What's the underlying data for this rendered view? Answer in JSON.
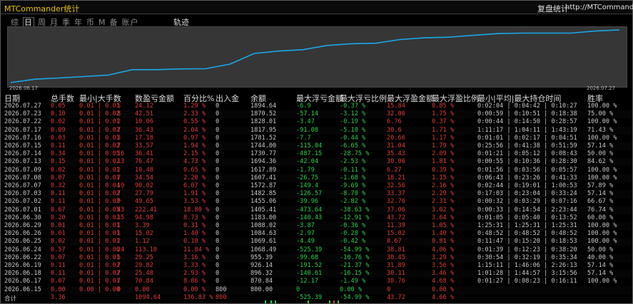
{
  "window": {
    "title": "MTCommander统计",
    "replay_label": "复盘统计",
    "url": "http://MTCommander"
  },
  "tabs": [
    "综",
    "日",
    "周",
    "月",
    "季",
    "年",
    "币",
    "M",
    "备",
    "账户"
  ],
  "selected_tab": "日",
  "track_label": "轨迹",
  "chart": {
    "start_date": "2026.06.17",
    "end_date": "2026.07.27",
    "line_color": "#1aa8e8",
    "bg_color": "#363636"
  },
  "chart_data": {
    "type": "line",
    "x": [
      "2026.06.17",
      "2026.06.18",
      "2026.06.19",
      "2026.06.22",
      "2026.06.24",
      "2026.06.25",
      "2026.06.26",
      "2026.06.29",
      "2026.06.30",
      "2026.07.01",
      "2026.07.02",
      "2026.07.03",
      "2026.07.06",
      "2026.07.07",
      "2026.07.08",
      "2026.07.09",
      "2026.07.13",
      "2026.07.14",
      "2026.07.15",
      "2026.07.16",
      "2026.07.17",
      "2026.07.20",
      "2026.07.21",
      "2026.07.22",
      "2026.07.23",
      "2026.07.27"
    ],
    "values": [
      800.0,
      870.84,
      896.32,
      926.14,
      955.39,
      1068.49,
      1069.61,
      1084.63,
      1088.02,
      1183.0,
      1405.41,
      1455.06,
      1482.85,
      1572.87,
      1607.41,
      1617.89,
      1694.36,
      1730.77,
      1744.0,
      1781.52,
      1817.95,
      1828.01,
      1828.01,
      1828.01,
      1870.52,
      1894.64
    ],
    "title": "",
    "xlabel": "",
    "ylabel": ""
  },
  "headers": {
    "date": "日期",
    "total": "总手数",
    "minmax": "最小|大手数",
    "count": "数盈亏金额",
    "pct": "百分比%",
    "io": "出入金",
    "balance": "余额",
    "max_float_loss": "最大浮亏金额",
    "max_float_loss_pct": "最大浮亏比例",
    "max_float_profit": "最大浮盈金额",
    "max_float_profit_pct": "最大浮盈比例",
    "hold_time": "最小|平均|最大持仓时间",
    "winrate": "胜率"
  },
  "rows": [
    {
      "date": "2026.07.27",
      "total": "0.05",
      "minmax": "0.01 | 0.01",
      "cnt": "5",
      "amt": "24.12",
      "pct": "1.29 %",
      "io": "0",
      "bal": "1894.64",
      "fl": "-6.9",
      "flp": "-0.37 %",
      "fp": "15.84",
      "fpp": "0.85 %",
      "ts": "0:02:04 | 0:04:42 | 0:10:27",
      "win": "100.00 %"
    },
    {
      "date": "2026.07.23",
      "total": "0.10",
      "minmax": "0.01 | 0.02",
      "cnt": "8",
      "amt": "42.51",
      "pct": "2.33 %",
      "io": "0",
      "bal": "1870.52",
      "fl": "-57.14",
      "flp": "-3.12 %",
      "fp": "32.06",
      "fpp": "1.75 %",
      "ts": "0:00:59 | 0:10:51 | 0:18:38",
      "win": "75.00 %"
    },
    {
      "date": "2026.07.22",
      "total": "0.02",
      "minmax": "0.01 | 0.01",
      "cnt": "2",
      "amt": "10.06",
      "pct": "0.55 %",
      "io": "0",
      "bal": "1828.01",
      "fl": "-3.47",
      "flp": "-0.19 %",
      "fp": "6.76",
      "fpp": "0.37 %",
      "ts": "0:00:44 | 0:14:50 | 0:28:57",
      "win": "100.00 %"
    },
    {
      "date": "2026.07.17",
      "total": "0.09",
      "minmax": "0.01 | 0.02",
      "cnt": "7",
      "amt": "36.43",
      "pct": "2.04 %",
      "io": "0",
      "bal": "1817.95",
      "fl": "-91.08",
      "flp": "-5.10 %",
      "fp": "30.6",
      "fpp": "1.71 %",
      "ts": "1:11:17 | 1:04:11 | 1:43:19",
      "win": "71.43 %"
    },
    {
      "date": "2026.07.16",
      "total": "0.03",
      "minmax": "0.01 | 0.01",
      "cnt": "3",
      "amt": "17.18",
      "pct": "0.97 %",
      "io": "0",
      "bal": "1781.52",
      "fl": "-7.7",
      "flp": "-0.44 %",
      "fp": "20.66",
      "fpp": "1.17 %",
      "ts": "0:01:01 | 0:02:17 | 0:04:51",
      "win": "100.00 %"
    },
    {
      "date": "2026.07.15",
      "total": "0.11",
      "minmax": "0.01 | 0.02",
      "cnt": "7",
      "amt": "33.57",
      "pct": "1.94 %",
      "io": "0",
      "bal": "1744.00",
      "fl": "-115.04",
      "flp": "-6.65 %",
      "fp": "31.04",
      "fpp": "1.79 %",
      "ts": "0:25:56 | 0:41:38 | 0:51:59",
      "win": "57.14 %"
    },
    {
      "date": "2026.07.14",
      "total": "0.34",
      "minmax": "0.01 | 0.05",
      "cnt": "16",
      "amt": "36.41",
      "pct": "2.15 %",
      "io": "0",
      "bal": "1730.77",
      "fl": "-487.15",
      "flp": "-28.75 %",
      "fp": "35.43",
      "fpp": "2.09 %",
      "ts": "0:01:21 | 0:05:12 | 0:08:43",
      "win": "50.00 %"
    },
    {
      "date": "2026.07.13",
      "total": "0.15",
      "minmax": "0.01 | 0.02",
      "cnt": "13",
      "amt": "76.47",
      "pct": "4.73 %",
      "io": "0",
      "bal": "1694.36",
      "fl": "-42.04",
      "flp": "-2.53 %",
      "fp": "30.06",
      "fpp": "1.81 %",
      "ts": "0:00:55 | 0:10:36 | 0:28:30",
      "win": "84.62 %"
    },
    {
      "date": "2026.07.09",
      "total": "0.02",
      "minmax": "0.01 | 0.01",
      "cnt": "2",
      "amt": "10.48",
      "pct": "0.65 %",
      "io": "0",
      "bal": "1617.89",
      "fl": "-1.79",
      "flp": "-0.11 %",
      "fp": "6.27",
      "fpp": "0.39 %",
      "ts": "0:01:56 | 0:03:56 | 0:05:57",
      "win": "100.00 %"
    },
    {
      "date": "2026.07.08",
      "total": "0.07",
      "minmax": "0.01 | 0.01",
      "cnt": "7",
      "amt": "34.54",
      "pct": "2.20 %",
      "io": "0",
      "bal": "1607.41",
      "fl": "-26.75",
      "flp": "-1.68 %",
      "fp": "18.21",
      "fpp": "1.15 %",
      "ts": "0:06:43 | 0:23:26 | 0:41:33",
      "win": "100.00 %"
    },
    {
      "date": "2026.07.07",
      "total": "0.32",
      "minmax": "0.01 | 0.04",
      "cnt": "19",
      "amt": "90.02",
      "pct": "6.07 %",
      "io": "0",
      "bal": "1572.87",
      "fl": "-149.4",
      "flp": "-9.69 %",
      "fp": "32.56",
      "fpp": "2.16 %",
      "ts": "0:02:44 | 0:19:01 | 1:00:53",
      "win": "57.89 %"
    },
    {
      "date": "2026.07.03",
      "total": "0.11",
      "minmax": "0.01 | 0.02",
      "cnt": "7",
      "amt": "27.79",
      "pct": "1.91 %",
      "io": "0",
      "bal": "1482.85",
      "fl": "-126.57",
      "flp": "-8.70 %",
      "fp": "33.37",
      "fpp": "2.29 %",
      "ts": "0:17:03 | 0:23:04 | 0:33:24",
      "win": "57.14 %"
    },
    {
      "date": "2026.07.02",
      "total": "0.11",
      "minmax": "0.01 | 0.02",
      "cnt": "9",
      "amt": "49.65",
      "pct": "3.53 %",
      "io": "0",
      "bal": "1455.06",
      "fl": "-39.96",
      "flp": "-2.82 %",
      "fp": "32.76",
      "fpp": "2.31 %",
      "ts": "0:00:32 | 0:03:29 | 0:07:16",
      "win": "66.67 %"
    },
    {
      "date": "2026.07.01",
      "total": "0.67",
      "minmax": "0.01 | 0.05",
      "cnt": "43",
      "amt": "222.41",
      "pct": "18.80 %",
      "io": "0",
      "bal": "1405.41",
      "fl": "-473.64",
      "flp": "-38.63 %",
      "fp": "37.06",
      "fpp": "3.02 %",
      "ts": "0:00:33 | 0:14:54 | 2:23:44",
      "win": "76.74 %"
    },
    {
      "date": "2026.06.30",
      "total": "0.20",
      "minmax": "0.01 | 0.02",
      "cnt": "15",
      "amt": "94.98",
      "pct": "8.73 %",
      "io": "0",
      "bal": "1183.00",
      "fl": "-140.43",
      "flp": "-12.91 %",
      "fp": "43.72",
      "fpp": "3.64 %",
      "ts": "0:01:05 | 0:05:40 | 0:13:52",
      "win": "60.00 %"
    },
    {
      "date": "2026.06.29",
      "total": "0.01",
      "minmax": "0.01 | 0.01",
      "cnt": "1",
      "amt": "3.39",
      "pct": "0.31 %",
      "io": "0",
      "bal": "1088.02",
      "fl": "-3.87",
      "flp": "-0.36 %",
      "fp": "11.39",
      "fpp": "1.05 %",
      "ts": "1:25:31 | 1:25:31 | 1:25:31",
      "win": "100.00 %"
    },
    {
      "date": "2026.06.26",
      "total": "0.01",
      "minmax": "0.01 | 0.01",
      "cnt": "1",
      "amt": "15.02",
      "pct": "1.40 %",
      "io": "0",
      "bal": "1084.63",
      "fl": "-2.97",
      "flp": "-0.28 %",
      "fp": "15.02",
      "fpp": "1.40 %",
      "ts": "0:48:52 | 0:48:52 | 0:48:52",
      "win": "100.00 %"
    },
    {
      "date": "2026.06.25",
      "total": "0.02",
      "minmax": "0.01 | 0.01",
      "cnt": "2",
      "amt": "1.12",
      "pct": "0.10 %",
      "io": "0",
      "bal": "1069.61",
      "fl": "-4.49",
      "flp": "-0.42 %",
      "fp": "8.67",
      "fpp": "0.81 %",
      "ts": "0:11:47 | 0:15:20 | 0:18:53",
      "win": "100.00 %"
    },
    {
      "date": "2026.06.24",
      "total": "0.57",
      "minmax": "0.01 | 0.06",
      "cnt": "24",
      "amt": "113.10",
      "pct": "11.84 %",
      "io": "0",
      "bal": "1068.49",
      "fl": "-525.39",
      "flp": "-54.99 %",
      "fp": "38.81",
      "fpp": "4.06 %",
      "ts": "0:01:39 | 0:12:23 | 0:38:20",
      "win": "50.00 %"
    },
    {
      "date": "2026.06.22",
      "total": "0.07",
      "minmax": "0.01 | 0.01",
      "cnt": "5",
      "amt": "29.25",
      "pct": "3.16 %",
      "io": "0",
      "bal": "955.39",
      "fl": "-99.68",
      "flp": "-10.76 %",
      "fp": "30.45",
      "fpp": "3.29 %",
      "ts": "0:30:54 | 0:32:19 | 0:35:34",
      "win": "40.00 %"
    },
    {
      "date": "2026.06.19",
      "total": "0.11",
      "minmax": "0.01 | 0.02",
      "cnt": "7",
      "amt": "29.82",
      "pct": "3.33 %",
      "io": "0",
      "bal": "926.14",
      "fl": "-191.52",
      "flp": "-21.37 %",
      "fp": "31.89",
      "fpp": "3.56 %",
      "ts": "1:15:11 | 1:46:06 | 2:26:13",
      "win": "57.14 %"
    },
    {
      "date": "2026.06.18",
      "total": "0.11",
      "minmax": "0.01 | 0.02",
      "cnt": "7",
      "amt": "25.48",
      "pct": "2.93 %",
      "io": "0",
      "bal": "896.32",
      "fl": "-140.61",
      "flp": "-16.15 %",
      "fp": "30.11",
      "fpp": "3.46 %",
      "ts": "1:01:28 | 1:44:57 | 3:15:56",
      "win": "57.14 %"
    },
    {
      "date": "2026.06.17",
      "total": "0.07",
      "minmax": "0.01 | 0.01",
      "cnt": "7",
      "amt": "70.84",
      "pct": "8.86 %",
      "io": "0",
      "bal": "870.84",
      "fl": "-12.17",
      "flp": "-1.49 %",
      "fp": "38.76",
      "fpp": "4.68 %",
      "ts": "0:01:27 | 0:08:23 | 0:16:11",
      "win": "100.00 %"
    },
    {
      "date": "2026.06.15",
      "total": "0.00",
      "minmax": "0.00 | 0.00",
      "cnt": "0",
      "amt": "0.00",
      "pct": "0.00 %",
      "io": "800",
      "bal": "800.00",
      "fl": "0",
      "flp": "0.00 %",
      "fp": "0",
      "fpp": "0.00 %",
      "ts": "",
      "win": ""
    }
  ],
  "total_row": {
    "label": "合计",
    "total": "3.36",
    "amt": "1094.64",
    "pct": "136.83 %",
    "io": "800",
    "bal": "",
    "fl": "-525.39",
    "flp": "-54.99 %",
    "fp": "43.72",
    "fpp": "4.66 %"
  },
  "colors": {
    "profit_red": "#e03a3a",
    "loss_green": "#2ad04a",
    "text_grey": "#c8c8c8",
    "title_yellow": "#e6c200"
  }
}
